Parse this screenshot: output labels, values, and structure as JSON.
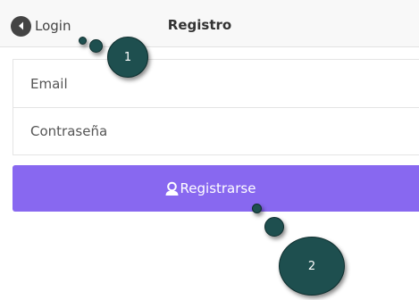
{
  "header": {
    "back_label": "Login",
    "title": "Registro"
  },
  "form": {
    "email_placeholder": "Email",
    "password_placeholder": "Contraseña"
  },
  "register_button": {
    "label": "Registrarse",
    "color": "#8868f0"
  },
  "annotations": [
    {
      "number": "1"
    },
    {
      "number": "2"
    }
  ],
  "icons": {
    "back": "chevron-left-circle-icon",
    "register": "user-icon"
  },
  "colors": {
    "accent": "#8868f0",
    "annotation": "#1e4f4f"
  }
}
